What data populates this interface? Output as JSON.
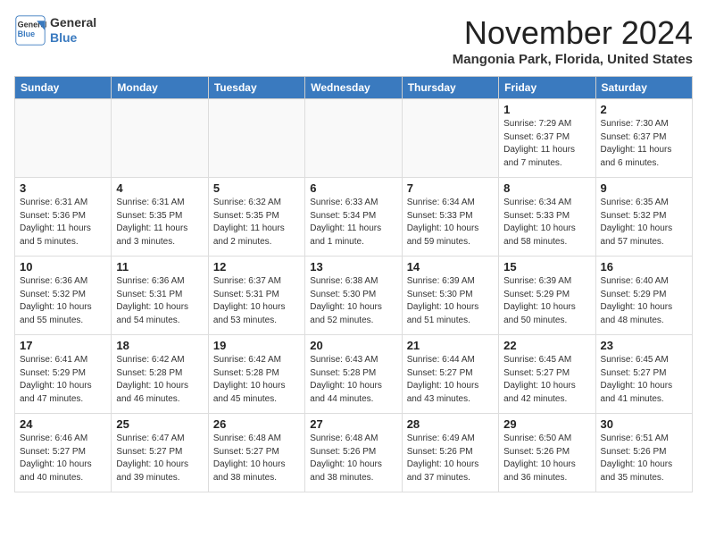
{
  "header": {
    "logo_line1": "General",
    "logo_line2": "Blue",
    "month_year": "November 2024",
    "location": "Mangonia Park, Florida, United States"
  },
  "weekdays": [
    "Sunday",
    "Monday",
    "Tuesday",
    "Wednesday",
    "Thursday",
    "Friday",
    "Saturday"
  ],
  "weeks": [
    [
      {
        "day": "",
        "info": ""
      },
      {
        "day": "",
        "info": ""
      },
      {
        "day": "",
        "info": ""
      },
      {
        "day": "",
        "info": ""
      },
      {
        "day": "",
        "info": ""
      },
      {
        "day": "1",
        "info": "Sunrise: 7:29 AM\nSunset: 6:37 PM\nDaylight: 11 hours and 7 minutes."
      },
      {
        "day": "2",
        "info": "Sunrise: 7:30 AM\nSunset: 6:37 PM\nDaylight: 11 hours and 6 minutes."
      }
    ],
    [
      {
        "day": "3",
        "info": "Sunrise: 6:31 AM\nSunset: 5:36 PM\nDaylight: 11 hours and 5 minutes."
      },
      {
        "day": "4",
        "info": "Sunrise: 6:31 AM\nSunset: 5:35 PM\nDaylight: 11 hours and 3 minutes."
      },
      {
        "day": "5",
        "info": "Sunrise: 6:32 AM\nSunset: 5:35 PM\nDaylight: 11 hours and 2 minutes."
      },
      {
        "day": "6",
        "info": "Sunrise: 6:33 AM\nSunset: 5:34 PM\nDaylight: 11 hours and 1 minute."
      },
      {
        "day": "7",
        "info": "Sunrise: 6:34 AM\nSunset: 5:33 PM\nDaylight: 10 hours and 59 minutes."
      },
      {
        "day": "8",
        "info": "Sunrise: 6:34 AM\nSunset: 5:33 PM\nDaylight: 10 hours and 58 minutes."
      },
      {
        "day": "9",
        "info": "Sunrise: 6:35 AM\nSunset: 5:32 PM\nDaylight: 10 hours and 57 minutes."
      }
    ],
    [
      {
        "day": "10",
        "info": "Sunrise: 6:36 AM\nSunset: 5:32 PM\nDaylight: 10 hours and 55 minutes."
      },
      {
        "day": "11",
        "info": "Sunrise: 6:36 AM\nSunset: 5:31 PM\nDaylight: 10 hours and 54 minutes."
      },
      {
        "day": "12",
        "info": "Sunrise: 6:37 AM\nSunset: 5:31 PM\nDaylight: 10 hours and 53 minutes."
      },
      {
        "day": "13",
        "info": "Sunrise: 6:38 AM\nSunset: 5:30 PM\nDaylight: 10 hours and 52 minutes."
      },
      {
        "day": "14",
        "info": "Sunrise: 6:39 AM\nSunset: 5:30 PM\nDaylight: 10 hours and 51 minutes."
      },
      {
        "day": "15",
        "info": "Sunrise: 6:39 AM\nSunset: 5:29 PM\nDaylight: 10 hours and 50 minutes."
      },
      {
        "day": "16",
        "info": "Sunrise: 6:40 AM\nSunset: 5:29 PM\nDaylight: 10 hours and 48 minutes."
      }
    ],
    [
      {
        "day": "17",
        "info": "Sunrise: 6:41 AM\nSunset: 5:29 PM\nDaylight: 10 hours and 47 minutes."
      },
      {
        "day": "18",
        "info": "Sunrise: 6:42 AM\nSunset: 5:28 PM\nDaylight: 10 hours and 46 minutes."
      },
      {
        "day": "19",
        "info": "Sunrise: 6:42 AM\nSunset: 5:28 PM\nDaylight: 10 hours and 45 minutes."
      },
      {
        "day": "20",
        "info": "Sunrise: 6:43 AM\nSunset: 5:28 PM\nDaylight: 10 hours and 44 minutes."
      },
      {
        "day": "21",
        "info": "Sunrise: 6:44 AM\nSunset: 5:27 PM\nDaylight: 10 hours and 43 minutes."
      },
      {
        "day": "22",
        "info": "Sunrise: 6:45 AM\nSunset: 5:27 PM\nDaylight: 10 hours and 42 minutes."
      },
      {
        "day": "23",
        "info": "Sunrise: 6:45 AM\nSunset: 5:27 PM\nDaylight: 10 hours and 41 minutes."
      }
    ],
    [
      {
        "day": "24",
        "info": "Sunrise: 6:46 AM\nSunset: 5:27 PM\nDaylight: 10 hours and 40 minutes."
      },
      {
        "day": "25",
        "info": "Sunrise: 6:47 AM\nSunset: 5:27 PM\nDaylight: 10 hours and 39 minutes."
      },
      {
        "day": "26",
        "info": "Sunrise: 6:48 AM\nSunset: 5:27 PM\nDaylight: 10 hours and 38 minutes."
      },
      {
        "day": "27",
        "info": "Sunrise: 6:48 AM\nSunset: 5:26 PM\nDaylight: 10 hours and 38 minutes."
      },
      {
        "day": "28",
        "info": "Sunrise: 6:49 AM\nSunset: 5:26 PM\nDaylight: 10 hours and 37 minutes."
      },
      {
        "day": "29",
        "info": "Sunrise: 6:50 AM\nSunset: 5:26 PM\nDaylight: 10 hours and 36 minutes."
      },
      {
        "day": "30",
        "info": "Sunrise: 6:51 AM\nSunset: 5:26 PM\nDaylight: 10 hours and 35 minutes."
      }
    ]
  ]
}
